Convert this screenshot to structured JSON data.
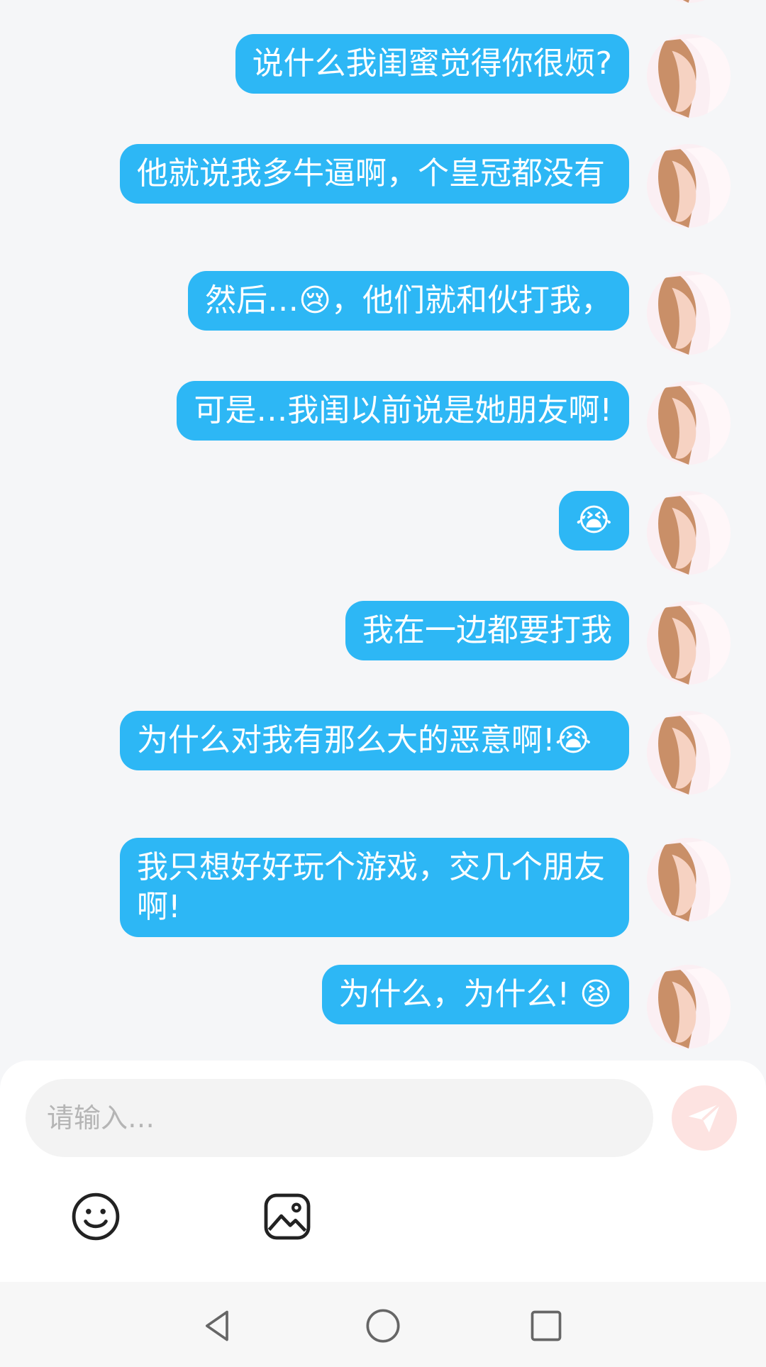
{
  "messages": [
    {
      "text": "说什么我闺蜜觉得你很烦?",
      "emoji": ""
    },
    {
      "text": "他就说我多牛逼啊，个皇冠都没有",
      "emoji": ""
    },
    {
      "text": "然后…😢，他们就和伙打我，",
      "emoji": ""
    },
    {
      "text": "可是…我闺以前说是她朋友啊!",
      "emoji": ""
    },
    {
      "text": "😭",
      "emoji": ""
    },
    {
      "text": "我在一边都要打我",
      "emoji": ""
    },
    {
      "text": "为什么对我有那么大的恶意啊!😭",
      "emoji": ""
    },
    {
      "text": "我只想好好玩个游戏，交几个朋友啊!",
      "emoji": ""
    },
    {
      "text": "为什么，为什么! 😫",
      "emoji": ""
    }
  ],
  "input": {
    "placeholder": "请输入…"
  },
  "toolbar": {
    "emoji_icon": "smiley-icon",
    "image_icon": "image-icon",
    "send_icon": "paper-plane-icon"
  },
  "colors": {
    "bubble": "#2db7f5",
    "send_button_bg": "#fde3e1",
    "send_icon": "#ffffff"
  },
  "nav": {
    "back_icon": "triangle-back-icon",
    "home_icon": "circle-home-icon",
    "recents_icon": "square-recents-icon"
  }
}
